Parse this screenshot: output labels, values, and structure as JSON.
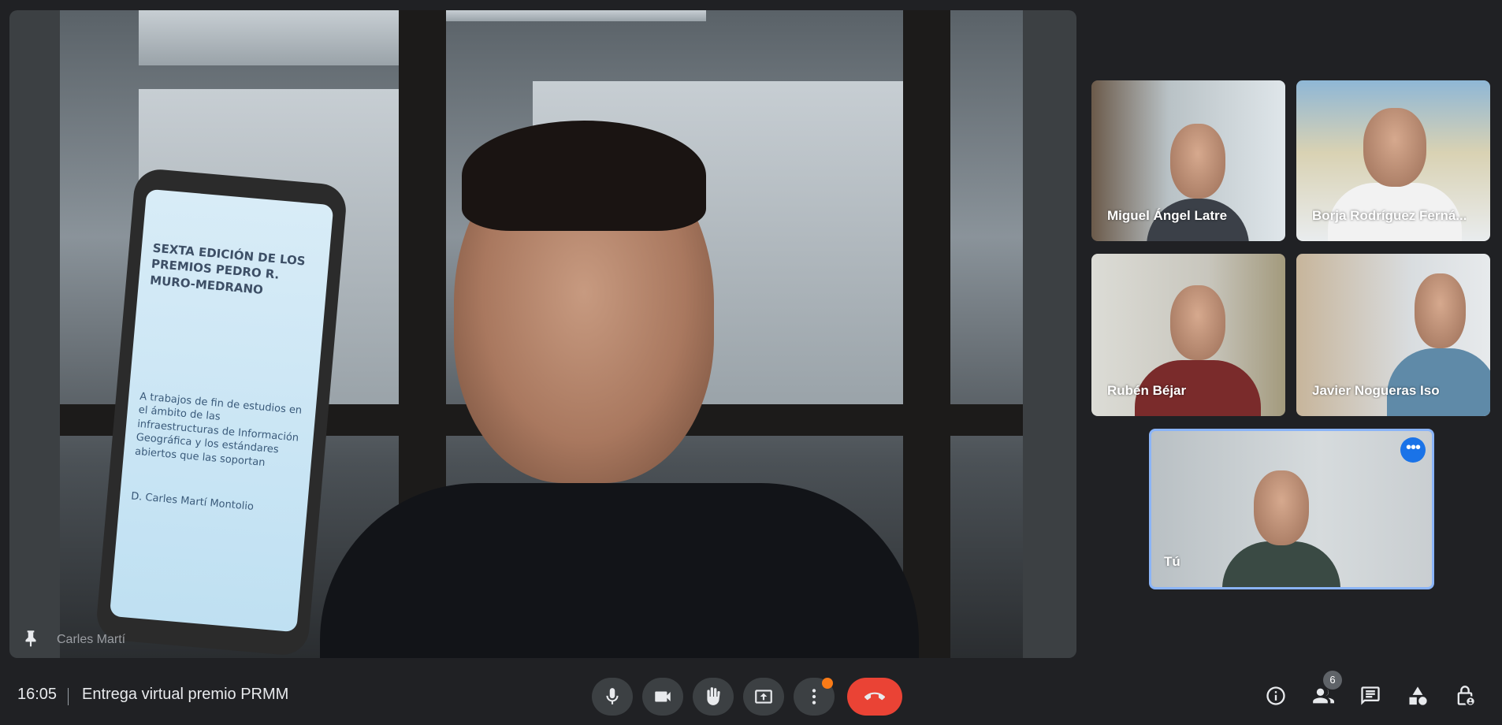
{
  "main_video": {
    "speaker_name": "Carles Martí",
    "phone_screen": {
      "heading": "SEXTA EDICIÓN DE LOS PREMIOS PEDRO R. MURO-MEDRANO",
      "body": "A trabajos de fin de estudios en el ámbito de las infraestructuras de Información Geográfica y los estándares abiertos que las soportan",
      "author": "D. Carles Martí Montolio"
    }
  },
  "participants": [
    {
      "name": "Miguel Ángel Latre"
    },
    {
      "name": "Borja Rodríguez Ferná..."
    },
    {
      "name": "Rubén Béjar"
    },
    {
      "name": "Javier Nogueras Iso"
    }
  ],
  "self_tile": {
    "name": "Tú",
    "more_label": "•••"
  },
  "bottom_bar": {
    "time": "16:05",
    "meeting_title": "Entrega virtual premio PRMM",
    "participant_count": "6"
  },
  "icons": {
    "mic": "mic-icon",
    "camera": "camera-icon",
    "raise_hand": "hand-icon",
    "present": "present-icon",
    "more": "more-vert-icon",
    "end_call": "end-call-icon",
    "info": "info-icon",
    "people": "people-icon",
    "chat": "chat-icon",
    "activities": "activities-icon",
    "host_controls": "lock-person-icon"
  },
  "colors": {
    "background": "#202124",
    "end_call": "#ea4335",
    "self_border": "#8ab4f8",
    "notification": "#fa7b17"
  }
}
